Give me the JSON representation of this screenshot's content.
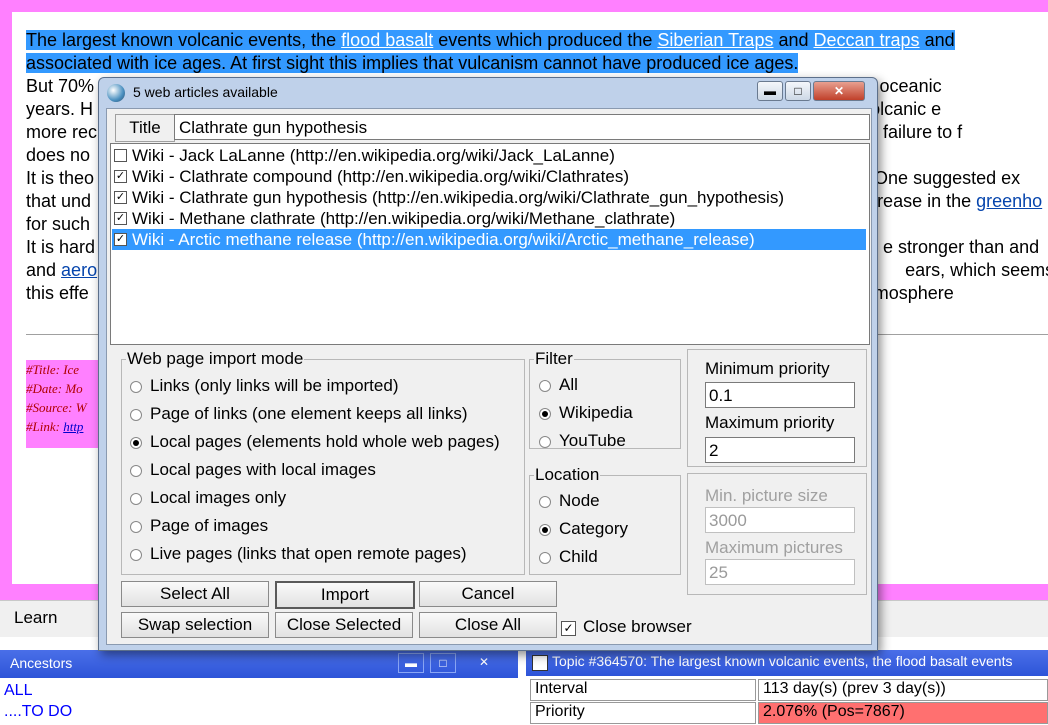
{
  "article": {
    "p1_a": "The largest known volcanic events, the ",
    "p1_link1": "flood basalt",
    "p1_b": " events which produced the ",
    "p1_link2": "Siberian Traps",
    "p1_c": " and ",
    "p1_link3": "Deccan traps",
    "p1_d": " and",
    "p1_line2": "associated with ice ages. At first sight this implies that vulcanism cannot have produced ice ages.",
    "p2_a": "But 70%",
    "p2_b": " the Earth's oceanic",
    "p3_a": "years. H",
    "p3_b": "undersea volcanic e",
    "p4_a": "more rec",
    "p4_b": "ords, our failure to f",
    "p5_a": "does no",
    "p6_a": "It is theo",
    "p6_b": ". One suggested ex",
    "p7_a": "that und",
    "p7_b": "rease in the ",
    "p7_link": "greenho",
    "p8_a": "for such",
    "p9_a": "It is hard",
    "p9_b": "e stronger than and",
    "p10_a": "and ",
    "p10_link": "aero",
    "p10_b": "ears, which seems v",
    "p11_a": "this effe",
    "p11_b": "atmosphere"
  },
  "meta": {
    "title": "#Title: Ice",
    "date": "#Date: Mo",
    "source": "#Source: W",
    "link_label": "#Link: ",
    "link": "http"
  },
  "learn_label": "Learn",
  "ancestors": {
    "title": "Ancestors",
    "items": [
      "ALL",
      "....TO DO"
    ]
  },
  "topic": {
    "title": "Topic #364570: The largest known volcanic events, the flood basalt events",
    "rows": [
      {
        "label": "Interval",
        "value": "113 day(s) (prev 3 day(s))"
      },
      {
        "label": "Priority",
        "value": "2.076% (Pos=7867)"
      }
    ]
  },
  "dialog": {
    "title": "5 web articles available",
    "title_label": "Title",
    "title_value": "Clathrate gun hypothesis",
    "articles": [
      {
        "checked": false,
        "text": "Wiki - Jack LaLanne (http://en.wikipedia.org/wiki/Jack_LaLanne)"
      },
      {
        "checked": true,
        "text": "Wiki - Clathrate compound (http://en.wikipedia.org/wiki/Clathrates)"
      },
      {
        "checked": true,
        "text": "Wiki - Clathrate gun hypothesis (http://en.wikipedia.org/wiki/Clathrate_gun_hypothesis)"
      },
      {
        "checked": true,
        "text": "Wiki - Methane clathrate (http://en.wikipedia.org/wiki/Methane_clathrate)"
      },
      {
        "checked": true,
        "text": "Wiki - Arctic methane release (http://en.wikipedia.org/wiki/Arctic_methane_release)"
      }
    ],
    "selected_article": 4,
    "import_mode": {
      "legend": "Web page import mode",
      "options": [
        "Links (only links will be imported)",
        "Page of links (one element keeps all links)",
        "Local pages (elements hold whole web pages)",
        "Local pages with local images",
        "Local images only",
        "Page of images",
        "Live pages (links that open remote pages)"
      ],
      "selected": 2
    },
    "filter": {
      "legend": "Filter",
      "options": [
        "All",
        "Wikipedia",
        "YouTube"
      ],
      "selected": 1
    },
    "location": {
      "legend": "Location",
      "options": [
        "Node",
        "Category",
        "Child"
      ],
      "selected": 1
    },
    "min_priority_label": "Minimum priority",
    "min_priority": "0.1",
    "max_priority_label": "Maximum priority",
    "max_priority": "2",
    "min_picture_label": "Min. picture size",
    "min_picture": "3000",
    "max_pictures_label": "Maximum pictures",
    "max_pictures": "25",
    "buttons": {
      "select_all": "Select All",
      "import": "Import",
      "cancel": "Cancel",
      "swap": "Swap selection",
      "close_selected": "Close Selected",
      "close_all": "Close All"
    },
    "close_browser_label": "Close browser",
    "close_browser_checked": true
  }
}
